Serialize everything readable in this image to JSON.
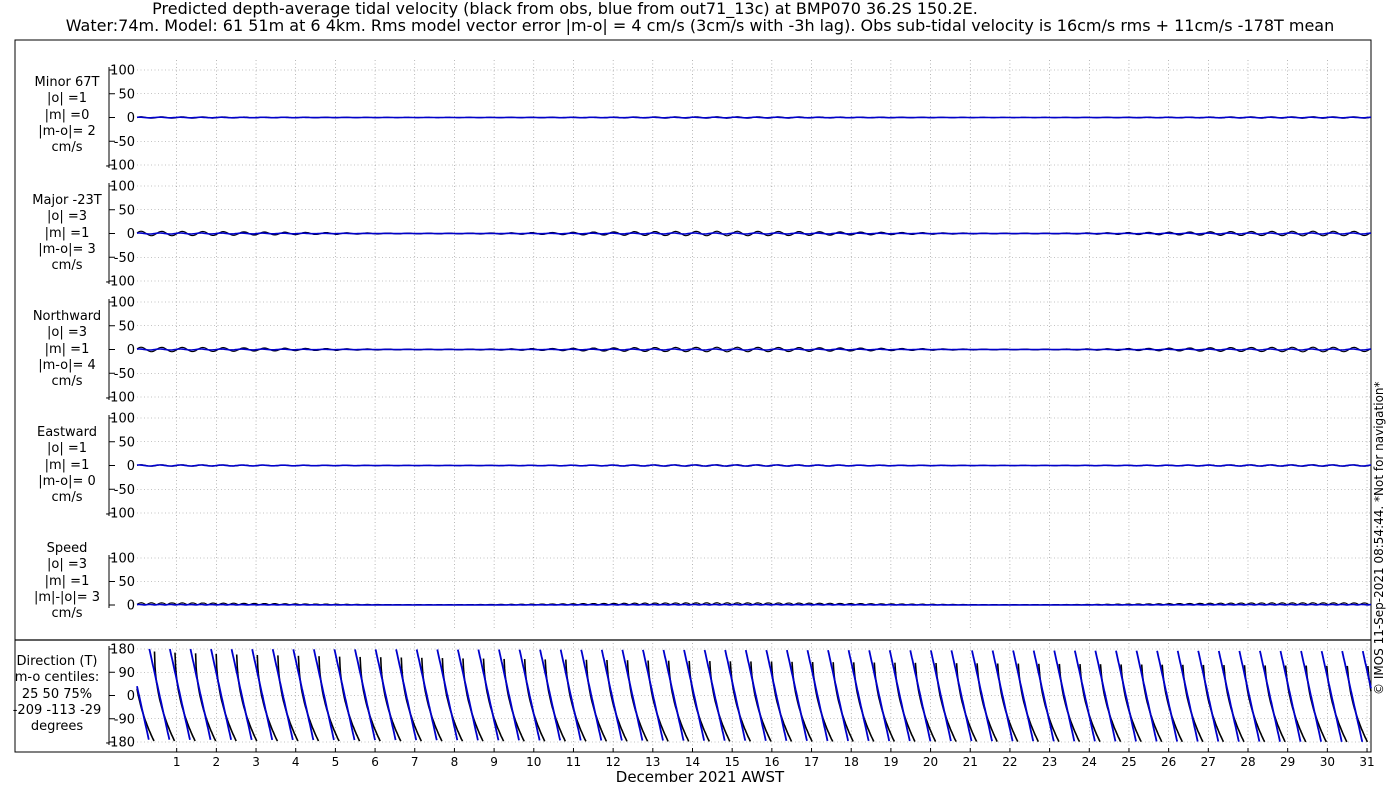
{
  "title_line1": "Predicted depth-average tidal velocity (black from obs, blue from out71_13c) at BMP070 36.2S 150.2E.",
  "title_line2": "Water:74m. Model: 61 51m at 6 4km. Rms model vector error |m-o| = 4 cm/s (3cm/s with -3h lag). Obs sub-tidal velocity is 16cm/s rms + 11cm/s -178T mean",
  "xlabel": "December 2021 AWST",
  "copyright": "© IMOS 11-Sep-2021 08:54:44. *Not for navigation*",
  "colors": {
    "obs": "#000000",
    "model": "#0000cc",
    "grid": "#888888"
  },
  "panels": [
    {
      "lines": [
        "Minor 67T",
        "|o| =1",
        "|m| =0",
        "|m-o|= 2",
        "cm/s"
      ]
    },
    {
      "lines": [
        "Major -23T",
        "|o| =3",
        "|m| =1",
        "|m-o|= 3",
        "cm/s"
      ]
    },
    {
      "lines": [
        "Northward",
        "|o| =3",
        "|m| =1",
        "|m-o|= 4",
        "cm/s"
      ]
    },
    {
      "lines": [
        "Eastward",
        "|o| =1",
        "|m| =1",
        "|m-o|= 0",
        "cm/s"
      ]
    },
    {
      "lines": [
        "Speed",
        "|o| =3",
        "|m| =1",
        "|m|-|o|= 3",
        "cm/s"
      ]
    },
    {
      "lines": [
        "Direction (T)",
        "m-o centiles:",
        "25  50  75%",
        "-209 -113  -29",
        "degrees"
      ]
    }
  ],
  "chart_data": {
    "type": "line",
    "x": {
      "label": "December 2021 AWST",
      "ticks": [
        "1",
        "2",
        "3",
        "4",
        "5",
        "6",
        "7",
        "8",
        "9",
        "10",
        "11",
        "12",
        "13",
        "14",
        "15",
        "16",
        "17",
        "18",
        "19",
        "20",
        "21",
        "22",
        "23",
        "24",
        "25",
        "26",
        "27",
        "28",
        "29",
        "30",
        "31"
      ],
      "range": [
        0,
        31.1
      ]
    },
    "legend": "none",
    "grid": true,
    "subplots": [
      {
        "name": "Minor 67T",
        "yticks": [
          "100",
          "50",
          "0",
          "-50",
          "-100"
        ],
        "ylim": [
          -100,
          100
        ],
        "unit": "cm/s",
        "series": [
          {
            "role": "obs",
            "color": "black",
            "amplitude": 1,
            "rms": 1
          },
          {
            "role": "model",
            "color": "blue",
            "amplitude": 0,
            "rms": 0
          }
        ]
      },
      {
        "name": "Major -23T",
        "yticks": [
          "100",
          "50",
          "0",
          "-50",
          "-100"
        ],
        "ylim": [
          -100,
          100
        ],
        "unit": "cm/s",
        "series": [
          {
            "role": "obs",
            "color": "black",
            "amplitude": 3,
            "rms": 3
          },
          {
            "role": "model",
            "color": "blue",
            "amplitude": 1,
            "rms": 1
          }
        ]
      },
      {
        "name": "Northward",
        "yticks": [
          "100",
          "50",
          "0",
          "-50",
          "-100"
        ],
        "ylim": [
          -100,
          100
        ],
        "unit": "cm/s",
        "series": [
          {
            "role": "obs",
            "color": "black",
            "amplitude": 3,
            "rms": 3
          },
          {
            "role": "model",
            "color": "blue",
            "amplitude": 1,
            "rms": 1
          }
        ]
      },
      {
        "name": "Eastward",
        "yticks": [
          "100",
          "50",
          "0",
          "-50",
          "-100"
        ],
        "ylim": [
          -100,
          100
        ],
        "unit": "cm/s",
        "series": [
          {
            "role": "obs",
            "color": "black",
            "amplitude": 1,
            "rms": 1
          },
          {
            "role": "model",
            "color": "blue",
            "amplitude": 1,
            "rms": 1
          }
        ]
      },
      {
        "name": "Speed",
        "yticks": [
          "100",
          "50",
          "0"
        ],
        "ylim": [
          0,
          100
        ],
        "unit": "cm/s",
        "series": [
          {
            "role": "obs",
            "color": "black",
            "amplitude": 3,
            "rms": 3
          },
          {
            "role": "model",
            "color": "blue",
            "amplitude": 1,
            "rms": 1
          }
        ]
      },
      {
        "name": "Direction (T)",
        "yticks": [
          "180",
          "90",
          "0",
          "-90",
          "-180"
        ],
        "ylim": [
          -180,
          180
        ],
        "unit": "degrees",
        "series": [
          {
            "role": "obs",
            "color": "black"
          },
          {
            "role": "model",
            "color": "blue"
          }
        ],
        "centiles": {
          "p25": -209,
          "p50": -113,
          "p75": -29
        }
      }
    ]
  }
}
